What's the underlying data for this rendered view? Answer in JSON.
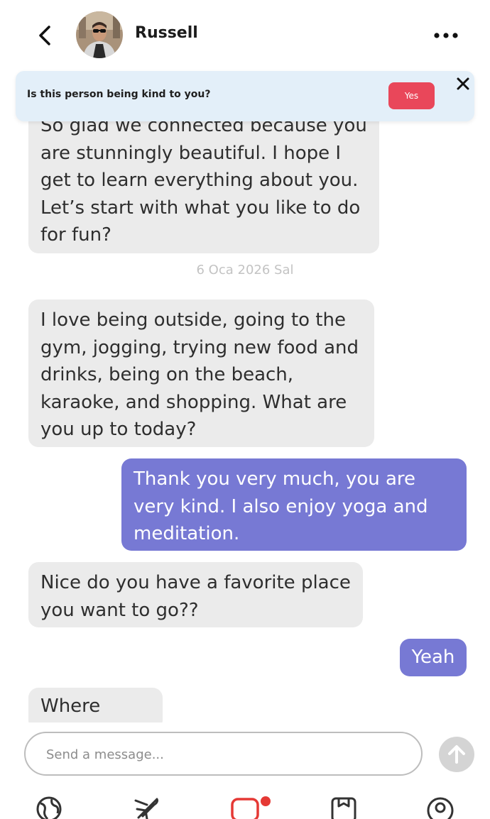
{
  "header": {
    "contact_name": "Russell"
  },
  "safety_prompt": {
    "question": "Is this person being kind to you?",
    "yes_label": "Yes"
  },
  "messages": [
    {
      "direction": "incoming",
      "text": "So glad we connected because you are stunningly beautiful. I hope I get to learn everything about you. Let’s start with what you like to do for fun?"
    },
    {
      "direction": "incoming",
      "text": "I love being outside, going to the gym, jogging, trying new food and drinks, being on the beach, karaoke, and shopping. What are you up to today?"
    },
    {
      "direction": "outgoing",
      "text": "Thank you very much, you are very kind.  I also enjoy yoga and meditation."
    },
    {
      "direction": "incoming",
      "text": "Nice do you have a favorite place you want to go??"
    },
    {
      "direction": "outgoing",
      "text": "Yeah"
    },
    {
      "direction": "incoming",
      "text": "Where cutie"
    }
  ],
  "date_separator": "6 Oca 2026 Sal",
  "composer": {
    "placeholder": "Send a message..."
  },
  "colors": {
    "outgoing_bubble": "#7779d4",
    "incoming_bubble": "#ebebeb",
    "banner_background": "#e3eff9",
    "yes_button": "#e9475a",
    "notification_dot": "#e53935",
    "active_tab": "#e53935"
  },
  "bottom_nav": {
    "items": [
      {
        "icon": "globe-icon"
      },
      {
        "icon": "plane-icon"
      },
      {
        "icon": "chat-icon",
        "active": true,
        "has_notification": true
      },
      {
        "icon": "bookmark-icon"
      },
      {
        "icon": "profile-icon"
      }
    ]
  }
}
